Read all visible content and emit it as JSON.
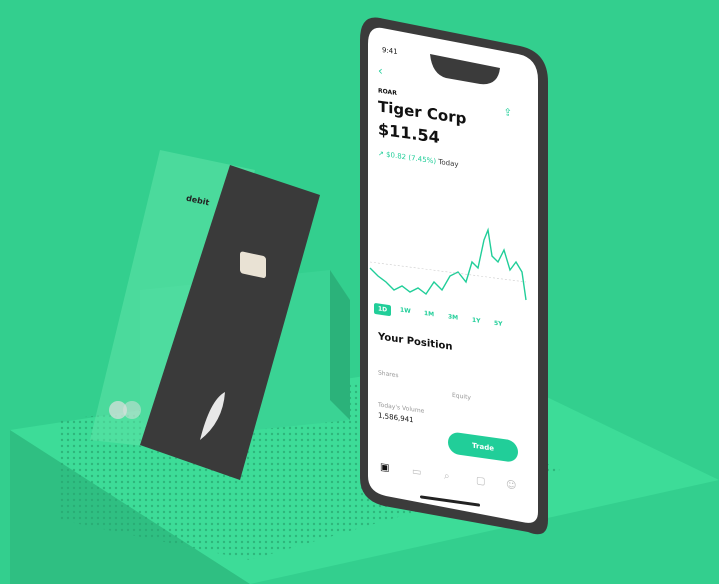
{
  "colors": {
    "background": "#33cf8e",
    "accent": "#21ce99",
    "platform": "#3fd895",
    "phone_frame": "#3b3b3b",
    "card": "#3a3a3a"
  },
  "phone": {
    "time": "9:41",
    "ticker": "ROAR",
    "company": "Tiger Corp",
    "price": "$11.54",
    "change": "↗ $0.82 (7.45%)",
    "change_suffix": "Today",
    "ranges": [
      "1D",
      "1W",
      "1M",
      "3M",
      "1Y",
      "5Y"
    ],
    "section_title": "Your Position",
    "shares_label": "Shares",
    "equity_label": "Equity",
    "volume_label": "Today's Volume",
    "volume_value": "1,586,941",
    "trade_button": "Trade",
    "tab_icons": [
      "chart-icon",
      "briefcase-icon",
      "search-icon",
      "chat-icon",
      "person-icon"
    ]
  },
  "card": {
    "label": "debit",
    "network_logo": "mastercard",
    "brand_icon": "feather-icon"
  }
}
